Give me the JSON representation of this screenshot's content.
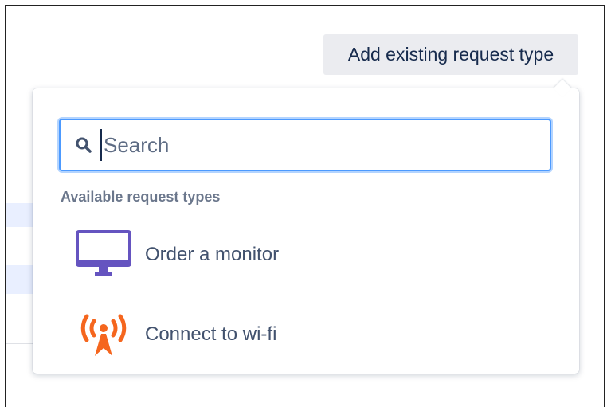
{
  "toolbar": {
    "add_existing_label": "Add existing request type"
  },
  "popover": {
    "search": {
      "placeholder": "Search",
      "value": ""
    },
    "section_label": "Available request types",
    "items": [
      {
        "label": "Order a monitor",
        "icon": "monitor-icon",
        "color": "#6554c0"
      },
      {
        "label": "Connect to wi-fi",
        "icon": "wifi-broadcast-icon",
        "color": "#f5661e"
      }
    ]
  },
  "colors": {
    "focus_border": "#4c9aff",
    "button_bg": "#ebecf0",
    "text_primary": "#172b4d",
    "text_secondary": "#6b778c"
  }
}
